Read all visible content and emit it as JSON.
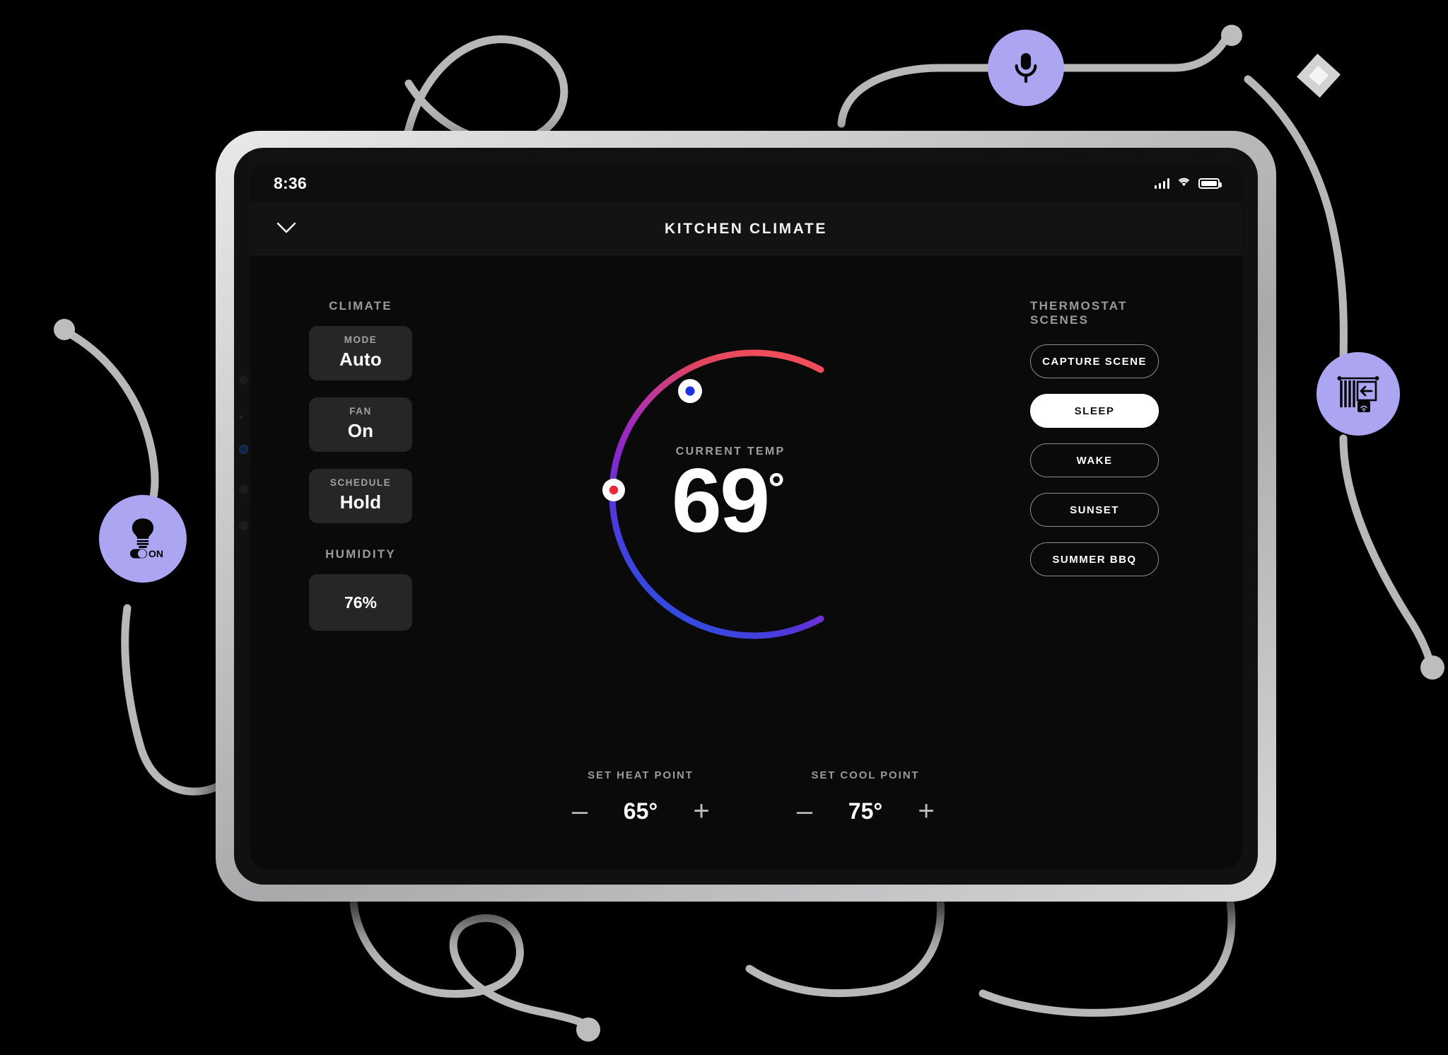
{
  "status_bar": {
    "time": "8:36",
    "icons": [
      "signal-bars-icon",
      "wifi-icon",
      "battery-icon"
    ]
  },
  "header": {
    "title": "KITCHEN CLIMATE",
    "back_icon": "chevron-down-icon"
  },
  "climate": {
    "section_label": "CLIMATE",
    "controls": [
      {
        "label": "MODE",
        "value": "Auto"
      },
      {
        "label": "FAN",
        "value": "On"
      },
      {
        "label": "SCHEDULE",
        "value": "Hold"
      }
    ],
    "humidity_label": "HUMIDITY",
    "humidity_value": "76%"
  },
  "dial": {
    "caption": "CURRENT TEMP",
    "current_temp": "69",
    "degree": "°",
    "gradient": {
      "hot": "#E8485A",
      "mid": "#A32CB8",
      "cold": "#2B4FE0"
    },
    "handles": [
      {
        "name": "cool-handle",
        "color": "#2130E2"
      },
      {
        "name": "heat-handle",
        "color": "#E8283C"
      }
    ]
  },
  "setpoints": [
    {
      "label": "SET HEAT POINT",
      "value": "65°",
      "decrement": "–",
      "increment": "+"
    },
    {
      "label": "SET COOL POINT",
      "value": "75°",
      "decrement": "–",
      "increment": "+"
    }
  ],
  "scenes": {
    "section_label": "THERMOSTAT SCENES",
    "items": [
      {
        "label": "CAPTURE SCENE",
        "active": false
      },
      {
        "label": "SLEEP",
        "active": true
      },
      {
        "label": "WAKE",
        "active": false
      },
      {
        "label": "SUNSET",
        "active": false
      },
      {
        "label": "SUMMER BBQ",
        "active": false
      }
    ]
  },
  "badges": [
    {
      "name": "microphone-badge",
      "icon": "microphone-icon",
      "color": "#ABA5F2"
    },
    {
      "name": "smart-light-badge",
      "icon": "lightbulb-toggle-on-icon",
      "label": "ON",
      "color": "#ABA5F2"
    },
    {
      "name": "smart-blinds-badge",
      "icon": "motorized-blinds-icon",
      "color": "#ABA5F2"
    }
  ],
  "decor": {
    "cable_color": "#b8b8b8",
    "node_color": "#bdbdbd"
  }
}
